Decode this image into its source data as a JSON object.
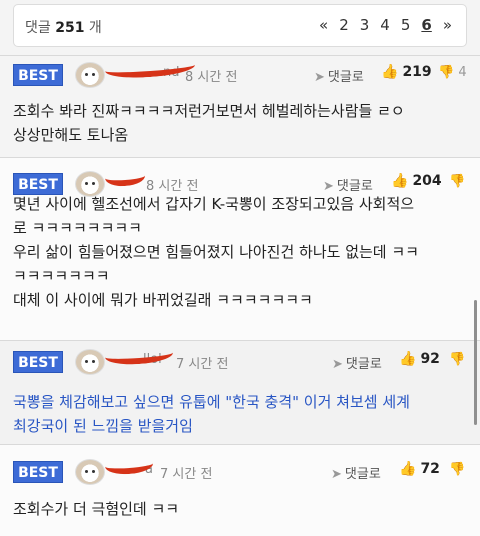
{
  "pager": {
    "count_label": "댓글",
    "count_value": "251",
    "count_unit": "개",
    "prev": "«",
    "pages": [
      "2",
      "3",
      "4",
      "5",
      "6"
    ],
    "current": "6",
    "next": "»"
  },
  "comments": [
    {
      "badge": "BEST",
      "nick": "nd",
      "time": "8 시간 전",
      "reply_label": "댓글로",
      "upvotes": "219",
      "downvotes": "4",
      "text_lines": [
        "조회수 봐라 진짜ㅋㅋㅋㅋ저런거보면서 헤벌레하는사람들 ㄹㅇ",
        "상상만해도 토나옴"
      ]
    },
    {
      "badge": "BEST",
      "nick": "",
      "time": "8 시간 전",
      "reply_label": "댓글로",
      "upvotes": "204",
      "downvotes": "",
      "text_lines": [
        "몇년 사이에 헬조선에서 갑자기 K-국뽕이 조장되고있음 사회적으",
        "로 ㅋㅋㅋㅋㅋㅋㅋㅋ",
        "우리 삶이 힘들어졌으면 힘들어졌지 나아진건 하나도 없는데 ㅋㅋ",
        "ㅋㅋㅋㅋㅋㅋㅋ",
        "대체 이 사이에 뭐가 바뀌었길래 ㅋㅋㅋㅋㅋㅋㅋ"
      ]
    },
    {
      "badge": "BEST",
      "nick": "llol",
      "time": "7 시간 전",
      "reply_label": "댓글로",
      "upvotes": "92",
      "downvotes": "",
      "text_lines": [
        "국뽕을 체감해보고 싶으면 유툽에 \"한국 충격\" 이거 쳐보셈 세계",
        "최강국이 된 느낌을 받을거임"
      ]
    },
    {
      "badge": "BEST",
      "nick": "a",
      "time": "7 시간 전",
      "reply_label": "댓글로",
      "upvotes": "72",
      "downvotes": "",
      "text_lines": [
        "조회수가 더 극혐인데 ㅋㅋ"
      ]
    }
  ]
}
